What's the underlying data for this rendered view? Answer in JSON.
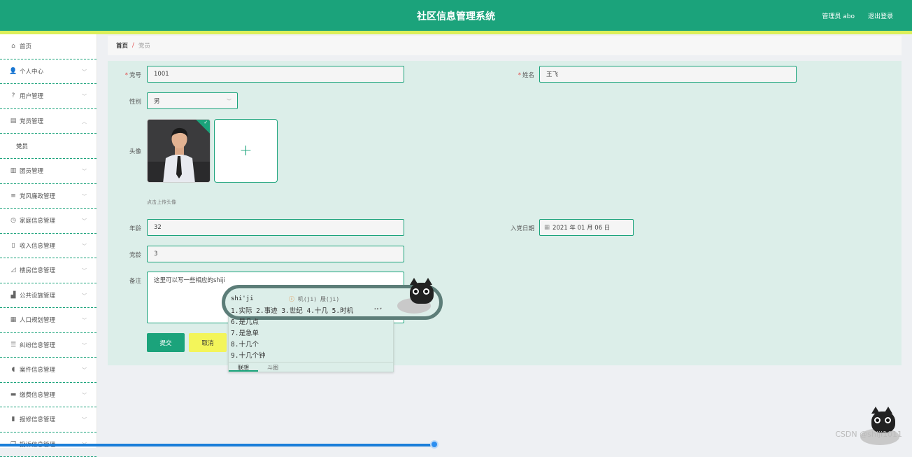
{
  "header": {
    "title": "社区信息管理系统",
    "user": "管理员 abo",
    "logout": "退出登录"
  },
  "sidebar": {
    "items": [
      {
        "label": "首页",
        "icon": "home-icon",
        "glyph": "⌂"
      },
      {
        "label": "个人中心",
        "icon": "user-icon",
        "glyph": "👤"
      },
      {
        "label": "用户管理",
        "icon": "help-circle-icon",
        "glyph": "?"
      },
      {
        "label": "党员管理",
        "icon": "ticket-icon",
        "glyph": "▤"
      },
      {
        "label": "团员管理",
        "icon": "document-icon",
        "glyph": "▥"
      },
      {
        "label": "党风廉政管理",
        "icon": "list-icon",
        "glyph": "≡"
      },
      {
        "label": "家庭信息管理",
        "icon": "clock-icon",
        "glyph": "◷"
      },
      {
        "label": "收入信息管理",
        "icon": "phone-icon",
        "glyph": "▯"
      },
      {
        "label": "楼房信息管理",
        "icon": "bell-off-icon",
        "glyph": "◿"
      },
      {
        "label": "公共设施管理",
        "icon": "building-icon",
        "glyph": "▟"
      },
      {
        "label": "人口规划管理",
        "icon": "grid-icon",
        "glyph": "▦"
      },
      {
        "label": "纠纷信息管理",
        "icon": "sliders-icon",
        "glyph": "☰"
      },
      {
        "label": "案件信息管理",
        "icon": "microphone-icon",
        "glyph": "◖"
      },
      {
        "label": "缴费信息管理",
        "icon": "card-icon",
        "glyph": "▬"
      },
      {
        "label": "报修信息管理",
        "icon": "bar-chart-icon",
        "glyph": "▮"
      },
      {
        "label": "投诉信息管理",
        "icon": "copy-icon",
        "glyph": "❐"
      }
    ],
    "active_sub": "党员"
  },
  "breadcrumb": {
    "home": "首页",
    "sep": "/",
    "current": "党员"
  },
  "form": {
    "member_no_label": "党号",
    "member_no_value": "1001",
    "name_label": "姓名",
    "name_value": "王飞",
    "gender_label": "性别",
    "gender_value": "男",
    "avatar_label": "头像",
    "upload_hint": "点击上传头像",
    "age_label": "年龄",
    "age_value": "32",
    "join_date_label": "入党日期",
    "join_date_value": "2021 年 01 月 06 日",
    "party_age_label": "党龄",
    "party_age_value": "3",
    "remark_label": "备注",
    "remark_value": "这里可以写一些相应的shiji",
    "submit": "提交",
    "cancel": "取消",
    "required_mark": "*"
  },
  "ime": {
    "pinyin": "shi'ji",
    "hint": "叽(ji) 屐(ji)",
    "row1": "1.实际  2.事迹  3.世纪  4.十几  5.时机",
    "candidates": [
      "6.是几点",
      "7.是急单",
      "8.十几个",
      "9.十几个钟"
    ],
    "tabs": [
      "联想",
      "斗图"
    ]
  },
  "watermark": "CSDN @shiji1011",
  "colors": {
    "accent": "#1ba37b",
    "strip": "#dcef5a",
    "cancel": "#f3f55a",
    "form_bg": "#dceee9"
  }
}
